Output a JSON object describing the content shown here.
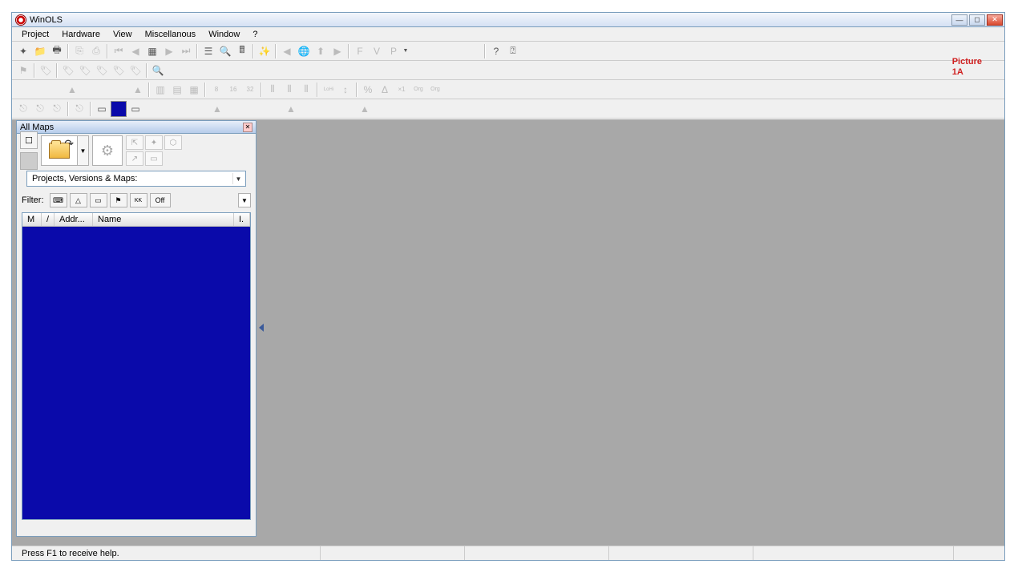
{
  "titlebar": {
    "title": "WinOLS"
  },
  "menu": {
    "project": "Project",
    "hardware": "Hardware",
    "view": "View",
    "misc": "Miscellanous",
    "window": "Window",
    "help": "?"
  },
  "picture_label": {
    "line1": "Picture",
    "line2": "1A"
  },
  "panel": {
    "title": "All Maps",
    "combo_label": "Projects, Versions & Maps:",
    "filter_label": "Filter:",
    "filter_off": "Off",
    "columns": {
      "m": "M",
      "slash": "/",
      "addr": "Addr...",
      "name": "Name",
      "i": "I."
    }
  },
  "statusbar": {
    "hint": "Press F1 to receive help."
  },
  "icons": {
    "new": "✦",
    "open": "📁",
    "print": "🖶",
    "copy": "⎘",
    "paste": "⎙",
    "first": "⏮",
    "prev": "◀",
    "grid": "▦",
    "next": "▶",
    "last": "⏭",
    "list": "☰",
    "zoom": "🔍",
    "calc": "🖩",
    "wand": "✨",
    "back": "◀",
    "globe": "🌐",
    "up": "⬆",
    "fwd": "▶",
    "f": "F",
    "v": "V",
    "p": "P",
    "q": "?",
    "qarrow": "⍰",
    "flag": "⚑",
    "tag": "🏷",
    "undo": "↶",
    "redo": "↷",
    "arrup": "▲",
    "arrdn": "▼",
    "bars1": "▥",
    "bars2": "▤",
    "bars3": "▦",
    "b8": "8",
    "b16": "16",
    "b32": "32",
    "g1": "⫴",
    "g2": "⫴",
    "g3": "⫴",
    "lohi": "LoHi",
    "updn": "↕",
    "pct": "%",
    "delta": "Δ",
    "x1": "×1",
    "org": "Org",
    "orgorg": "Org",
    "t1": "⎋",
    "t2": "⎋",
    "t3": "⎋",
    "c1": "▭",
    "c2": "■",
    "c3": "▭",
    "doc": "☐",
    "gray": "■",
    "gear": "⚙"
  }
}
